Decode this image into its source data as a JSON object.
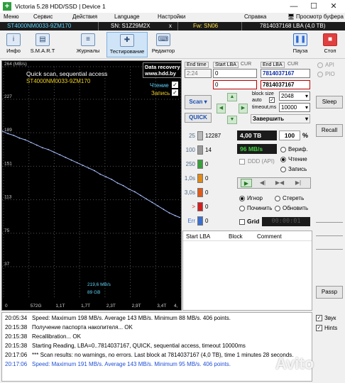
{
  "window": {
    "title": "Victoria 5.28 HDD/SSD | Device 1",
    "min": "—",
    "max": "☐",
    "close": "✕"
  },
  "menu": {
    "items": [
      "Меню",
      "Сервис",
      "Действия",
      "Language",
      "Настройки",
      "Справка"
    ],
    "viewer": "Просмотр буфера"
  },
  "devbar": {
    "model": "ST4000NM0033-9ZM170",
    "sn": "SN: S1Z29M2X",
    "close": "x",
    "fw": "Fw: SN06",
    "lba": "7814037168 LBA (4,0 TB)"
  },
  "toolbar": {
    "buttons": [
      "Инфо",
      "S.M.A.R.T",
      "Журналы",
      "Тестирование",
      "Редактор"
    ],
    "pause": "Пауза",
    "stop": "Стоп"
  },
  "graph": {
    "title": "Quick scan, sequential access",
    "model": "ST4000NM0033-9ZM170",
    "top_label": "264 (MB/s)",
    "badge_line1": "Data recovery",
    "badge_line2": "www.hdd.by",
    "read_label": "Чтение",
    "write_label": "Запись",
    "speed_label": "219,6 MB/s",
    "pos_label": "89 GB"
  },
  "chart_data": {
    "type": "line",
    "ylabel": "(MB/s)",
    "ylim": [
      0,
      264
    ],
    "y_ticks": [
      264,
      227,
      189,
      151,
      113,
      75,
      37
    ],
    "x_ticks": [
      "0",
      "572G",
      "1,1T",
      "1,7T",
      "2,3T",
      "2,9T",
      "3,4T",
      "4,"
    ],
    "series": [
      {
        "x": [
          0.0,
          0.13,
          0.26,
          0.39,
          0.52,
          0.65,
          0.78,
          0.91,
          1.04,
          1.17,
          1.3,
          1.43,
          1.56,
          1.69,
          1.82,
          1.95,
          2.08,
          2.21,
          2.34,
          2.47,
          2.6,
          2.73,
          2.86,
          2.99,
          3.12,
          3.25,
          3.38,
          3.51,
          3.64,
          3.77,
          3.9,
          4.0
        ],
        "y": [
          191,
          188,
          186,
          183,
          181,
          178,
          175,
          172,
          170,
          167,
          164,
          161,
          158,
          155,
          152,
          149,
          146,
          142,
          139,
          136,
          132,
          129,
          125,
          122,
          118,
          114,
          110,
          106,
          102,
          98,
          95,
          93
        ]
      }
    ]
  },
  "range": {
    "end_time_label": "End time",
    "end_time": "2:24",
    "start_lba_label": "Start LBA",
    "start_lba": "0",
    "end_lba_label": "End LBA",
    "end_lba": "7814037167",
    "cur_label": "CUR",
    "cur_value": "7814037167",
    "zero": "0",
    "block_size_label": "block size",
    "auto_label": "auto",
    "block_size": "2048",
    "timeout_label": "timeout,ms",
    "timeout": "10000",
    "scan_button": "Scan",
    "quick_button": "QUICK",
    "finish_select": "Завершить"
  },
  "counters": [
    {
      "label": "25",
      "value": "12287",
      "color": "#b9b9b9"
    },
    {
      "label": "100",
      "value": "14",
      "color": "#9a9a9a"
    },
    {
      "label": "250",
      "value": "0",
      "color": "#3aa03a"
    },
    {
      "label": "1,0s",
      "value": "0",
      "color": "#e08a1a"
    },
    {
      "label": "3,0s",
      "value": "0",
      "color": "#e05a1a"
    },
    {
      "label": ">",
      "value": "0",
      "color": "#d21e1e"
    },
    {
      "label": "Err",
      "value": "0",
      "color": "#3a6fd0"
    }
  ],
  "status": {
    "capacity": "4,00 TB",
    "percent": "100",
    "percent_unit": "%",
    "speed": "96 MB/s",
    "ddd": "DDD (API)",
    "verify": "Вериф.",
    "read": "Чтение",
    "write": "Запись",
    "ignore": "Игнор",
    "erase": "Стереть",
    "repair": "Починить",
    "refresh": "Обновить",
    "grid": "Grid",
    "timer": "00:00:01"
  },
  "table": {
    "headers": [
      "Start LBA",
      "Block",
      "Comment"
    ]
  },
  "side": {
    "api": "API",
    "pio": "PIO",
    "sleep": "Sleep",
    "recall": "Recall",
    "passp": "Passp",
    "sound": "Звук",
    "hints": "Hints"
  },
  "log": [
    {
      "time": "20:05:34",
      "text": "Speed: Maximum 198 MB/s. Average 143 MB/s. Minimum 88 MB/s. 406 points.",
      "color": "#000000"
    },
    {
      "time": "20:15:38",
      "text": "Получение паспорта накопителя... OK",
      "color": "#000000"
    },
    {
      "time": "20:15:38",
      "text": "Recallibration... OK",
      "color": "#000000"
    },
    {
      "time": "20:15:38",
      "text": "Starting Reading, LBA=0..7814037167, QUICK, sequential access, timeout 10000ms",
      "color": "#000000"
    },
    {
      "time": "20:17:06",
      "text": "*** Scan results: no warnings, no errors. Last block at 7814037167 (4,0 TB), time 1 minutes 28 seconds.",
      "color": "#000000"
    },
    {
      "time": "20:17:06",
      "text": "Speed: Maximum 191 MB/s. Average 143 MB/s. Minimum 95 MB/s. 406 points.",
      "color": "#1f4fd6"
    }
  ],
  "watermark": "Avito"
}
